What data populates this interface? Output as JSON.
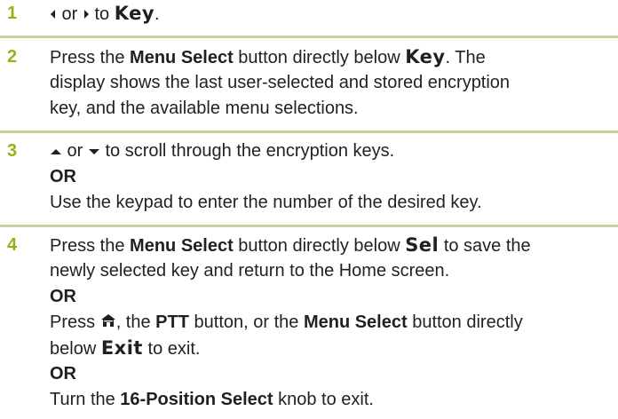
{
  "steps": [
    {
      "number": "1",
      "lines": [
        {
          "a": " or ",
          "b": " to ",
          "c": "Key",
          "d": "."
        }
      ]
    },
    {
      "number": "2",
      "lines": [
        {
          "a": "Press the ",
          "b": "Menu Select",
          "c": " button directly below ",
          "d": "Key",
          "e": ". The"
        },
        {
          "text": "display shows the last user-selected and stored encryption"
        },
        {
          "text": "key, and the available menu selections."
        }
      ]
    },
    {
      "number": "3",
      "lines": [
        {
          "a": " or ",
          "b": " to scroll through the encryption keys."
        },
        {
          "text": "OR"
        },
        {
          "text": "Use the keypad to enter the number of the desired key."
        }
      ]
    },
    {
      "number": "4",
      "lines": [
        {
          "a": "Press the ",
          "b": "Menu Select",
          "c": " button directly below ",
          "d": "Sel",
          "e": " to save the"
        },
        {
          "text": "newly selected key and return to the Home screen."
        },
        {
          "text": "OR"
        },
        {
          "a": "Press ",
          "b": ", the ",
          "c": "PTT",
          "d": " button, or the ",
          "e": "Menu Select",
          "f": " button directly"
        },
        {
          "a": "below ",
          "b": "Exit",
          "c": " to exit."
        },
        {
          "text": "OR"
        },
        {
          "a": "Turn the ",
          "b": "16-Position Select",
          "c": " knob to exit."
        }
      ]
    }
  ],
  "icons": [
    "left-arrow-icon",
    "right-arrow-icon",
    "up-arrow-icon",
    "down-arrow-icon",
    "home-icon"
  ],
  "colors": {
    "step_number": "#9aae1a",
    "rule": "#c9d29a",
    "text": "#231f20"
  }
}
